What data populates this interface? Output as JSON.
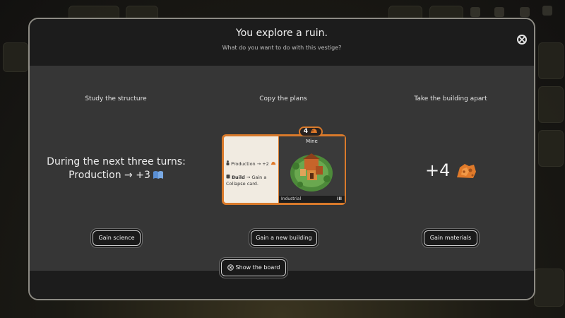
{
  "dialog": {
    "title": "You explore a ruin.",
    "subtitle": "What do you want to do with this vestige?",
    "close_icon": "close-icon"
  },
  "options": {
    "study": {
      "title": "Study the structure",
      "text_line1": "During the next three turns:",
      "text_line2": "Production → +3",
      "icon": "science-book-icon",
      "button": "Gain science"
    },
    "copy": {
      "title": "Copy the plans",
      "button": "Gain a new building",
      "card": {
        "cost": "4",
        "cost_icon": "materials-icon",
        "name": "Mine",
        "effect1": "Production → +2",
        "effect2_bold": "Build",
        "effect2_rest": " → Gain a Collapse card.",
        "type": "Industrial",
        "era": "III"
      }
    },
    "dismantle": {
      "title": "Take the building apart",
      "value": "+4",
      "icon": "materials-icon",
      "button": "Gain materials"
    }
  },
  "footer": {
    "show_board": "Show the board"
  },
  "colors": {
    "accent_orange": "#d97a2b",
    "science_blue": "#5a8fd4",
    "panel": "#363636",
    "header": "#1c1c1c"
  }
}
